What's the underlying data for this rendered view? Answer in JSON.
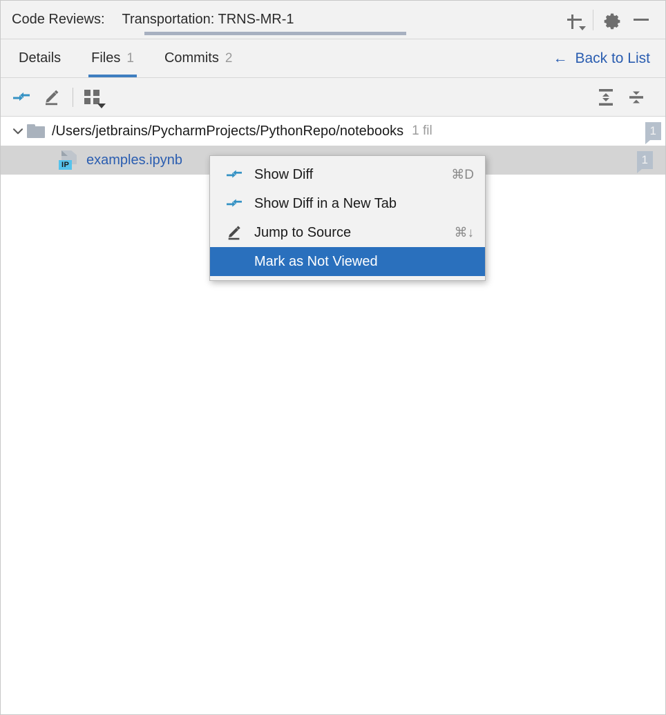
{
  "titlebar": {
    "section_label": "Code Reviews:",
    "review_title": "Transportation: TRNS-MR-1",
    "actions": {
      "add_label": "+",
      "settings_label": "Settings",
      "hide_label": "Hide"
    }
  },
  "tabs": {
    "items": [
      {
        "label": "Details",
        "count": "",
        "active": false
      },
      {
        "label": "Files",
        "count": "1",
        "active": true
      },
      {
        "label": "Commits",
        "count": "2",
        "active": false
      }
    ],
    "back_link": {
      "arrow": "←",
      "label": "Back to List"
    }
  },
  "toolbar": {
    "show_diff_label": "Show Diff",
    "jump_to_source_label": "Jump to Source",
    "group_by_label": "Group By",
    "expand_all_label": "Expand All",
    "collapse_all_label": "Collapse All"
  },
  "tree": {
    "directory": {
      "path": "/Users/jetbrains/PycharmProjects/PythonRepo/notebooks",
      "meta": "1 fil",
      "badge": "1",
      "expanded": true
    },
    "file": {
      "name": "examples.ipynb",
      "icon_label": "IP",
      "badge": "1",
      "selected": true
    }
  },
  "context_menu": {
    "items": [
      {
        "label": "Show Diff",
        "shortcut": "⌘D",
        "icon": "diff-icon",
        "selected": false
      },
      {
        "label": "Show Diff in a New Tab",
        "shortcut": "",
        "icon": "diff-icon",
        "selected": false
      },
      {
        "label": "Jump to Source",
        "shortcut": "⌘↓",
        "icon": "pencil-icon",
        "selected": false
      },
      {
        "label": "Mark as Not Viewed",
        "shortcut": "",
        "icon": "",
        "selected": true
      }
    ]
  },
  "colors": {
    "accent_blue": "#3e7ec0",
    "selection_blue": "#2a70bd",
    "link_blue": "#2a5db0",
    "panel_bg": "#f2f2f2",
    "row_selected": "#d4d4d4",
    "icon_blue": "#3592c4"
  }
}
